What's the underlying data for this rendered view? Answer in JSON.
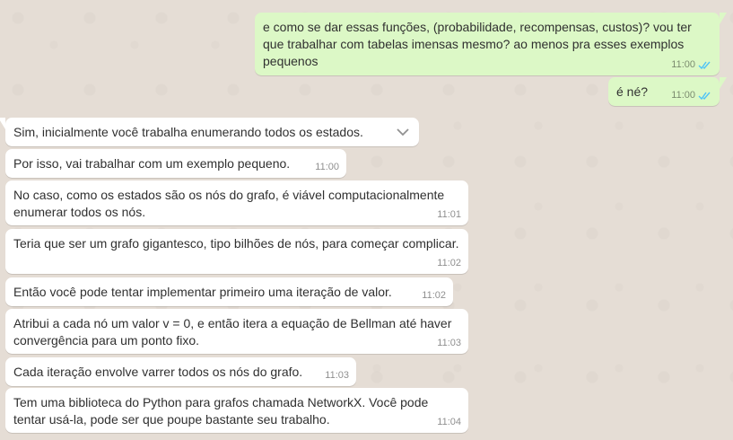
{
  "messages_out": [
    {
      "text": "e como se dar essas funções, (probabilidade, recompensas, custos)? vou ter que trabalhar com tabelas imensas mesmo? ao menos pra esses exemplos pequenos",
      "time": "11:00",
      "status": "read-double-check"
    },
    {
      "text": "é né?",
      "time": "11:00",
      "status": "read-double-check"
    }
  ],
  "messages_in": [
    {
      "text": "Sim, inicialmente você trabalha enumerando todos os estados.",
      "time": ""
    },
    {
      "text": "Por isso, vai trabalhar com um exemplo pequeno.",
      "time": "11:00"
    },
    {
      "text": "No caso, como os estados são os nós do grafo, é viável computacionalmente enumerar todos os nós.",
      "time": "11:01"
    },
    {
      "text": "Teria que ser um grafo gigantesco, tipo bilhões de nós, para começar complicar.",
      "time": "11:02"
    },
    {
      "text": "Então você pode tentar implementar primeiro uma iteração de valor.",
      "time": "11:02"
    },
    {
      "text": "Atribui a cada nó um valor v = 0, e então itera a equação de Bellman até haver convergência para um ponto fixo.",
      "time": "11:03"
    },
    {
      "text": "Cada iteração envolve varrer todos os nós do grafo.",
      "time": "11:03"
    },
    {
      "text": "Tem uma biblioteca do Python para grafos chamada NetworkX. Você pode tentar usá-la, pode ser que poupe bastante seu trabalho.",
      "time": "11:04"
    }
  ],
  "colors": {
    "outgoing_bubble": "#dcf8c6",
    "incoming_bubble": "#ffffff",
    "chat_background": "#e5ddd5",
    "read_ticks": "#4fc3f7"
  },
  "icons": {
    "message_menu": "chevron-down-icon",
    "read_receipt": "double-check-icon"
  }
}
